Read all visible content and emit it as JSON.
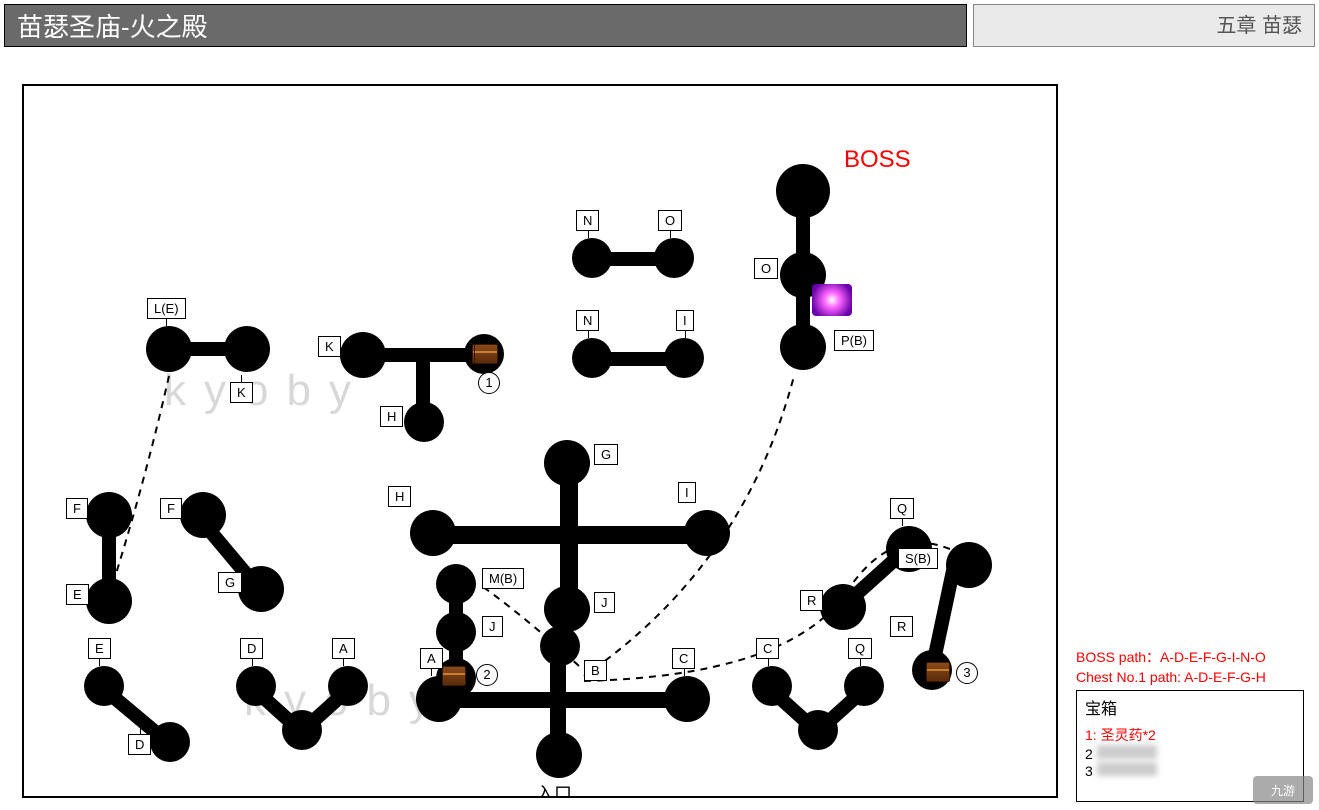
{
  "header": {
    "title": "苗瑟圣庙-火之殿",
    "chapter": "五章 苗瑟"
  },
  "paths": {
    "boss": "BOSS path：A-D-E-F-G-I-N-O",
    "chest1": "Chest No.1 path: A-D-E-F-G-H"
  },
  "legend": {
    "title": "宝箱",
    "items": [
      {
        "num": "1",
        "text": "圣灵药*2",
        "red": true
      },
      {
        "num": "2",
        "text": "",
        "blur": true
      },
      {
        "num": "3",
        "text": "",
        "blur": true
      }
    ]
  },
  "boss_label": "BOSS",
  "entry_label": "入口",
  "watermark": "kyoby",
  "logo": "九游",
  "node_labels": {
    "LE": "L(E)",
    "K1": "K",
    "K2": "K",
    "F1": "F",
    "F2": "F",
    "E1": "E",
    "G1": "G",
    "E2": "E",
    "D1": "D",
    "D2": "D",
    "A1": "A",
    "H1": "H",
    "H2": "H",
    "N1": "N",
    "O1": "O",
    "N2": "N",
    "I1": "I",
    "O2": "O",
    "PB": "P(B)",
    "G2": "G",
    "I2": "I",
    "MB": "M(B)",
    "J1": "J",
    "J2": "J",
    "B": "B",
    "A2": "A",
    "C1": "C",
    "C2": "C",
    "Q1": "Q",
    "R1": "R",
    "Q2": "Q",
    "SB": "S(B)",
    "R2": "R"
  },
  "chest_nums": {
    "one": "1",
    "two": "2",
    "three": "3"
  }
}
